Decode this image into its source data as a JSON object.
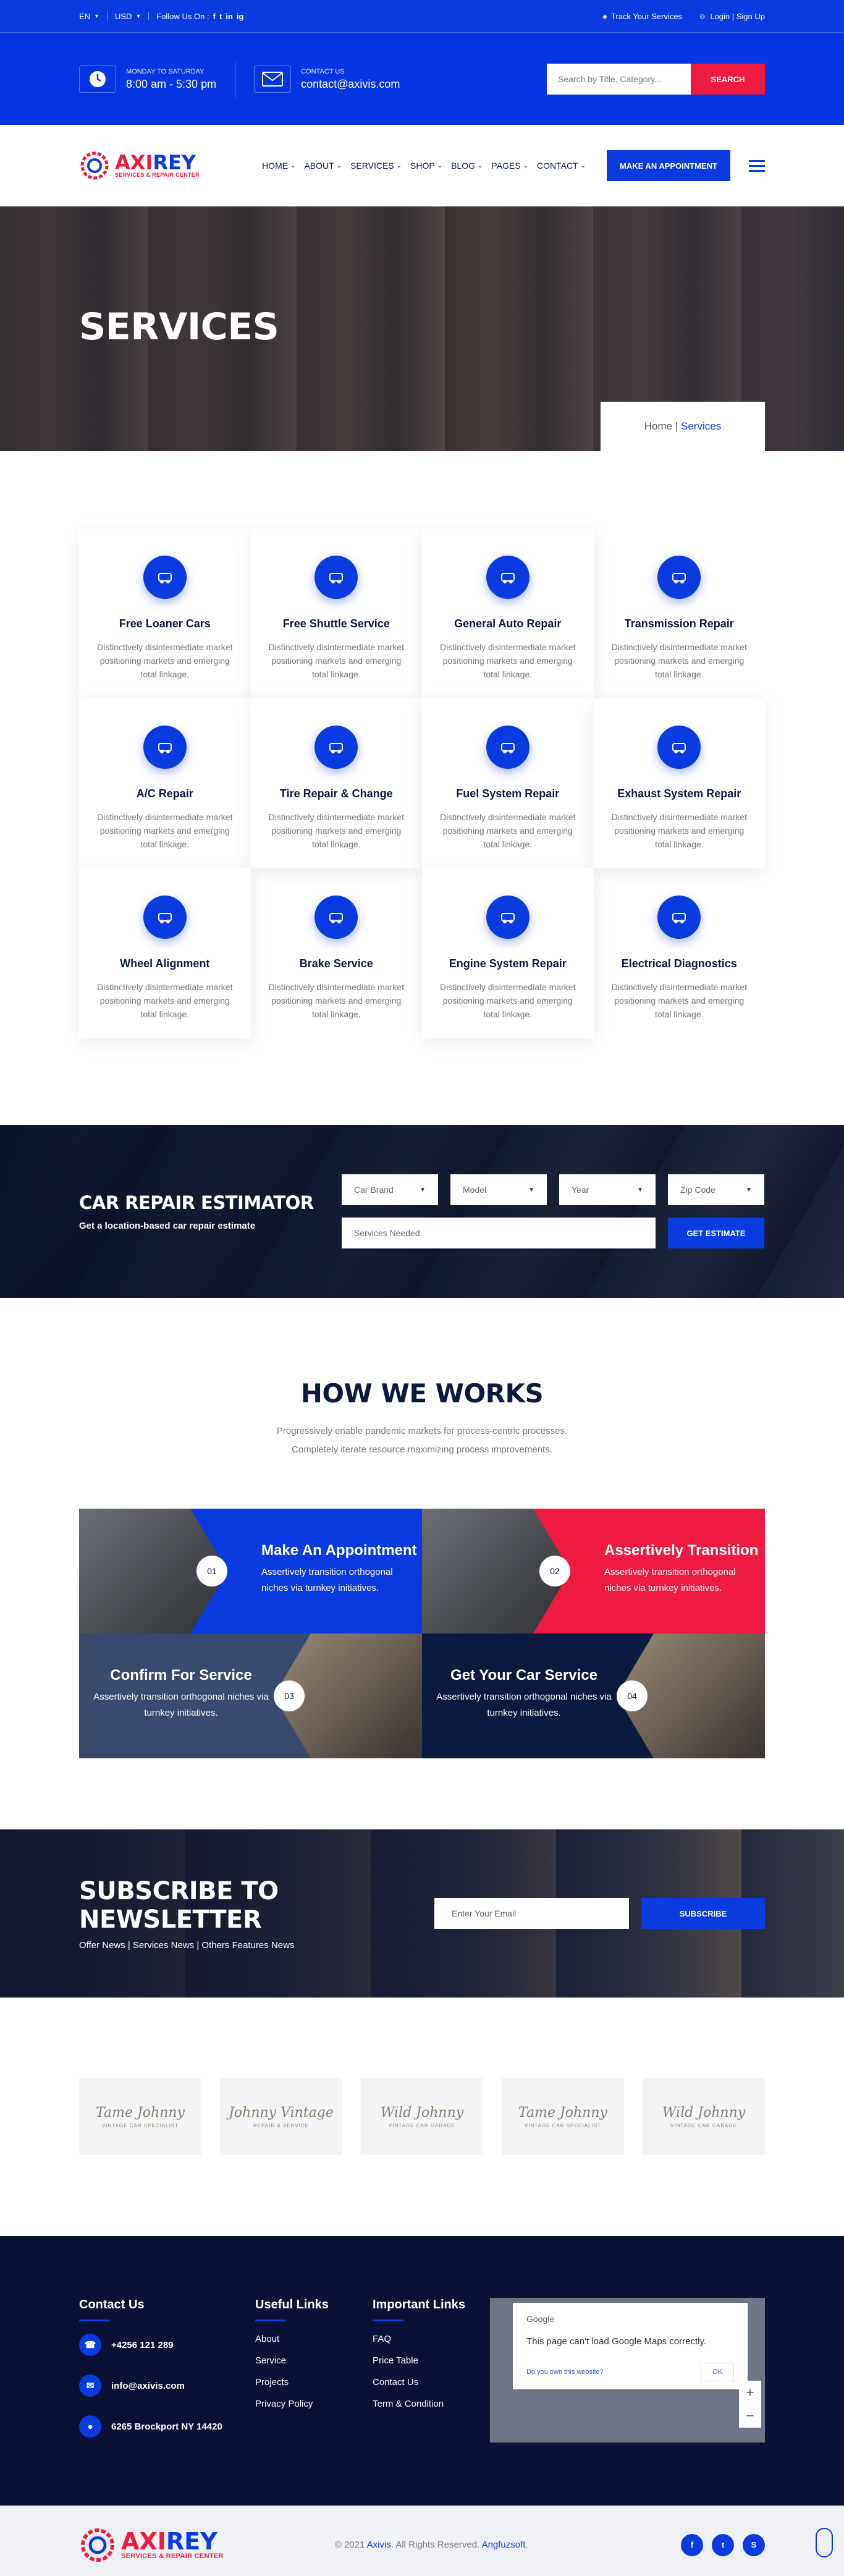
{
  "topbar": {
    "lang": "EN",
    "currency": "USD",
    "follow_label": "Follow Us On :",
    "social": [
      "f",
      "t",
      "in",
      "ig"
    ],
    "track": "Track Your Services",
    "login": "Login | Sign Up"
  },
  "header": {
    "hours_label": "MONDAY TO SATURDAY",
    "hours": "8:00 am - 5:30 pm",
    "contact_label": "CONTACT US",
    "email": "contact@axivis.com",
    "search_placeholder": "Search by Title, Category...",
    "search_button": "SEARCH"
  },
  "logo": {
    "part1": "AXI",
    "part2": "REY",
    "tagline": "SERVICES & REPAIR CENTER"
  },
  "nav": {
    "items": [
      "HOME",
      "ABOUT",
      "SERVICES",
      "SHOP",
      "BLOG",
      "PAGES",
      "CONTACT"
    ],
    "cta": "MAKE AN APPOINTMENT"
  },
  "hero": {
    "title": "SERVICES",
    "crumb_home": "Home",
    "crumb_sep": " | ",
    "crumb_current": "Services"
  },
  "services": [
    {
      "title": "Free Loaner Cars",
      "desc": "Distinctively disintermediate market positioning markets and emerging total linkage.",
      "icon": "loaner-car-icon"
    },
    {
      "title": "Free Shuttle Service",
      "desc": "Distinctively disintermediate market positioning markets and emerging total linkage.",
      "icon": "shuttle-icon"
    },
    {
      "title": "General Auto Repair",
      "desc": "Distinctively disintermediate market positioning markets and emerging total linkage.",
      "icon": "auto-repair-icon"
    },
    {
      "title": "Transmission Repair",
      "desc": "Distinctively disintermediate market positioning markets and emerging total linkage.",
      "icon": "transmission-icon"
    },
    {
      "title": "A/C Repair",
      "desc": "Distinctively disintermediate market positioning markets and emerging total linkage.",
      "icon": "ac-icon"
    },
    {
      "title": "Tire Repair & Change",
      "desc": "Distinctively disintermediate market positioning markets and emerging total linkage.",
      "icon": "tire-icon"
    },
    {
      "title": "Fuel System Repair",
      "desc": "Distinctively disintermediate market positioning markets and emerging total linkage.",
      "icon": "fuel-icon"
    },
    {
      "title": "Exhaust System Repair",
      "desc": "Distinctively disintermediate market positioning markets and emerging total linkage.",
      "icon": "exhaust-icon"
    },
    {
      "title": "Wheel Alignment",
      "desc": "Distinctively disintermediate market positioning markets and emerging total linkage.",
      "icon": "wheel-alignment-icon"
    },
    {
      "title": "Brake Service",
      "desc": "Distinctively disintermediate market positioning markets and emerging total linkage.",
      "icon": "brake-icon"
    },
    {
      "title": "Engine System Repair",
      "desc": "Distinctively disintermediate market positioning markets and emerging total linkage.",
      "icon": "engine-icon"
    },
    {
      "title": "Electrical Diagnostics",
      "desc": "Distinctively disintermediate market positioning markets and emerging total linkage.",
      "icon": "electrical-icon"
    }
  ],
  "estimator": {
    "title": "CAR REPAIR ESTIMATOR",
    "subtitle": "Get a location-based car repair estimate",
    "selects": [
      "Car Brand",
      "Model",
      "Year",
      "Zip Code"
    ],
    "services_placeholder": "Services Needed",
    "button": "GET ESTIMATE"
  },
  "how": {
    "title": "HOW WE WORKS",
    "sub1": "Progressively enable pandemic markets for process-centric processes.",
    "sub2": "Completely iterate resource maximizing process improvements.",
    "steps": [
      {
        "num": "01",
        "title": "Make An Appointment",
        "desc": "Assertively transition orthogonal niches via turnkey initiatives.",
        "color": "#0a3be0"
      },
      {
        "num": "02",
        "title": "Assertively Transition",
        "desc": "Assertively transition orthogonal niches via turnkey initiatives.",
        "color": "#ef1a3f"
      },
      {
        "num": "03",
        "title": "Confirm For Service",
        "desc": "Assertively transition orthogonal niches via turnkey initiatives.",
        "color": "#3a4a6e"
      },
      {
        "num": "04",
        "title": "Get Your Car Service",
        "desc": "Assertively transition orthogonal niches via turnkey initiatives.",
        "color": "#0c1a40"
      }
    ]
  },
  "newsletter": {
    "title": "SUBSCRIBE TO NEWSLETTER",
    "sub": "Offer News | Services News | Others Features News",
    "placeholder": "Enter Your Email",
    "button": "SUBSCRIBE"
  },
  "brands": [
    {
      "line1": "Tame Johnny",
      "line2": "VINTAGE CAR SPECIALIST"
    },
    {
      "line1": "Johnny Vintage",
      "line2": "REPAIR & SERVICE"
    },
    {
      "line1": "Wild Johnny",
      "line2": "VINTAGE CAR GARAGE"
    },
    {
      "line1": "Tame Johnny",
      "line2": "VINTAGE CAR SPECIALIST"
    },
    {
      "line1": "Wild Johnny",
      "line2": "VINTAGE CAR GARAGE"
    }
  ],
  "footer": {
    "contact_title": "Contact Us",
    "phone": "+4256 121 289",
    "email": "info@axivis.com",
    "address": "6265 Brockport NY 14420",
    "links_title": "Useful Links",
    "links": [
      "About",
      "Service",
      "Projects",
      "Privacy Policy"
    ],
    "important_title": "Important Links",
    "important": [
      "FAQ",
      "Price Table",
      "Contact Us",
      "Term & Condition"
    ],
    "map_google": "Google",
    "map_msg": "This page can't load Google Maps correctly.",
    "map_q": "Do you own this website?",
    "map_ok": "OK"
  },
  "copyright": {
    "pre": "© 2021 ",
    "brand": "Axivis",
    "mid": ". All Rights Reserved. ",
    "author": "Angfuzsoft",
    "end": "."
  },
  "colors": {
    "primary": "#0a3be0",
    "accent": "#ef1a3f",
    "dark": "#0c1a40"
  }
}
